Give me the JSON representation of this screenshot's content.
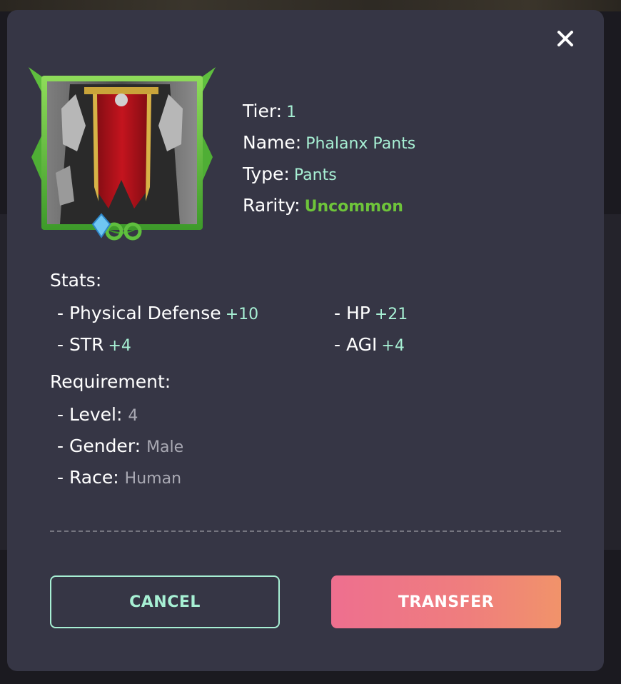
{
  "modal": {
    "close_icon": "close-icon",
    "item_image": "phalanx-pants-portrait",
    "info": {
      "tier_label": "Tier:",
      "tier_value": "1",
      "name_label": "Name:",
      "name_value": "Phalanx Pants",
      "type_label": "Type:",
      "type_value": "Pants",
      "rarity_label": "Rarity:",
      "rarity_value": "Uncommon"
    },
    "stats": {
      "title": "Stats:",
      "items": [
        {
          "label": "- Physical Defense",
          "value": "+10"
        },
        {
          "label": "- HP",
          "value": "+21"
        },
        {
          "label": "- STR",
          "value": "+4"
        },
        {
          "label": "- AGI",
          "value": "+4"
        }
      ]
    },
    "requirement": {
      "title": "Requirement:",
      "items": [
        {
          "label": "- Level:",
          "value": "4"
        },
        {
          "label": "- Gender:",
          "value": "Male"
        },
        {
          "label": "- Race:",
          "value": "Human"
        }
      ]
    },
    "buttons": {
      "cancel": "CANCEL",
      "transfer": "TRANSFER"
    }
  },
  "colors": {
    "modal_bg": "#363645",
    "value_accent": "#a7f0d4",
    "rarity_uncommon": "#6ec43a",
    "muted_value": "#a9a9b3",
    "transfer_gradient_start": "#ee6f8f",
    "transfer_gradient_end": "#f1936a"
  }
}
